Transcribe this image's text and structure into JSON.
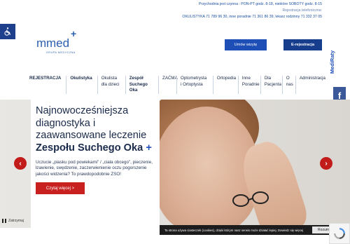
{
  "header": {
    "hours_line": "Przychodnia jest czynna :  PON-PT godz. 8-18, niektóre SOBOTY godz. 8-15",
    "phone_label": "Rejestracja telefoniczna:",
    "phone_line": "OKULISTYKA 71 789 96 30, inne poradnie 71 361 86 39, lekarz rodzinny  71 332 37 05",
    "logo_m": "m",
    "logo_med": "med",
    "logo_plus": "+",
    "logo_sub": "GRUPA MEDYCZNA",
    "visit_button": "Umów wizytę",
    "ereg_button": "E-rejestracja"
  },
  "nav": {
    "items": [
      {
        "label": "REJESTRACJA"
      },
      {
        "label": "Okulistyka"
      },
      {
        "label": "Okulista dla dzieci"
      },
      {
        "label": "Zespół Suchego Oka"
      },
      {
        "label": "ZAĆMA"
      },
      {
        "label": "Optometrysta i Ortoptysta"
      },
      {
        "label": "Ortopedia"
      },
      {
        "label": "Inne Poradnie"
      },
      {
        "label": "Dla Pacjenta"
      },
      {
        "label": "O nas"
      },
      {
        "label": "Administracja"
      }
    ]
  },
  "side": {
    "medi_label": "MediRaty",
    "fb_label": "f"
  },
  "hero": {
    "title_part1": "Najnowocześniejsza diagnostyka i zaawansowane leczenie ",
    "title_bold": "Zespołu Suchego Oka",
    "title_plus": "+",
    "description": "Uczucie „piasku pod powiekami” / „ciała obcego”, pieczenie, łzawienie, swędzenie, zaczerwienienie oczu pogorszenie jakości widzenia? To prawdopodobnie ZSO!",
    "button": "Czytaj więcej >",
    "prev_arrow": "‹",
    "next_arrow": "›",
    "pause_label": "Zatrzymaj"
  },
  "cookie": {
    "text": "Ta strona używa ciasteczek (cookies), dzięki którym nasz serwis może działać lepiej.  Dowiedz się więcej",
    "ok_button": "Rozumiem"
  },
  "colors": {
    "primary": "#1e4fb7",
    "dark_navy": "#173d8d",
    "accent_red": "#c8201f",
    "facebook": "#3b5998"
  }
}
